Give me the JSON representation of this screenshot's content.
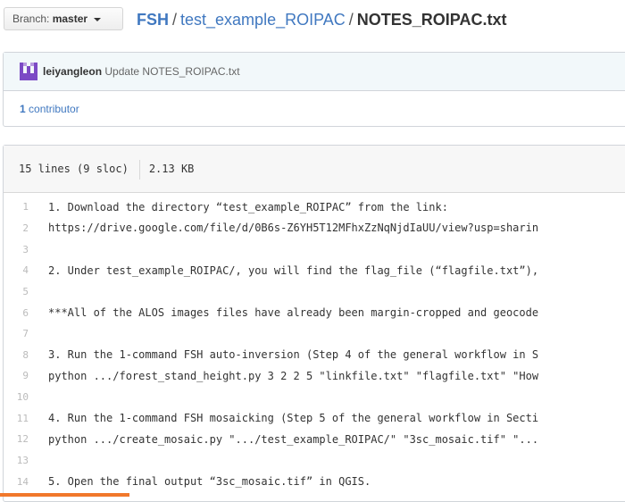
{
  "branch": {
    "label": "Branch:",
    "name": "master"
  },
  "breadcrumb": {
    "root": "FSH",
    "sep1": "/",
    "folder": "test_example_ROIPAC",
    "sep2": "/",
    "file": "NOTES_ROIPAC.txt"
  },
  "commit": {
    "author": "leiyangleon",
    "message": "Update NOTES_ROIPAC.txt"
  },
  "contributors": {
    "count": "1",
    "label": "contributor"
  },
  "file_info": {
    "lines": "15 lines (9 sloc)",
    "size": "2.13 KB"
  },
  "code_lines": [
    {
      "n": "1",
      "text": "1. Download the directory “test_example_ROIPAC” from the link:"
    },
    {
      "n": "2",
      "text": "https://drive.google.com/file/d/0B6s-Z6YH5T12MFhxZzNqNjdIaUU/view?usp=sharin"
    },
    {
      "n": "3",
      "text": ""
    },
    {
      "n": "4",
      "text": "2. Under test_example_ROIPAC/, you will find the flag_file (“flagfile.txt”),"
    },
    {
      "n": "5",
      "text": ""
    },
    {
      "n": "6",
      "text": "***All of the ALOS images files have already been margin-cropped and geocode"
    },
    {
      "n": "7",
      "text": ""
    },
    {
      "n": "8",
      "text": "3. Run the 1-command FSH auto-inversion (Step 4 of the general workflow in S"
    },
    {
      "n": "9",
      "text": "python .../forest_stand_height.py 3 2 2 5 \"linkfile.txt\" \"flagfile.txt\" \"How"
    },
    {
      "n": "10",
      "text": ""
    },
    {
      "n": "11",
      "text": "4. Run the 1-command FSH mosaicking (Step 5 of the general workflow in Secti"
    },
    {
      "n": "12",
      "text": "python .../create_mosaic.py \".../test_example_ROIPAC/\" \"3sc_mosaic.tif\" \"..."
    },
    {
      "n": "13",
      "text": ""
    },
    {
      "n": "14",
      "text": "5. Open the final output “3sc_mosaic.tif” in QGIS."
    }
  ],
  "colors": {
    "link": "#4078c0",
    "accent": "#f1782b",
    "avatar": "#7c4ac5"
  },
  "icons": {
    "branch_caret": "caret-down-icon",
    "avatar": "avatar-identicon"
  }
}
